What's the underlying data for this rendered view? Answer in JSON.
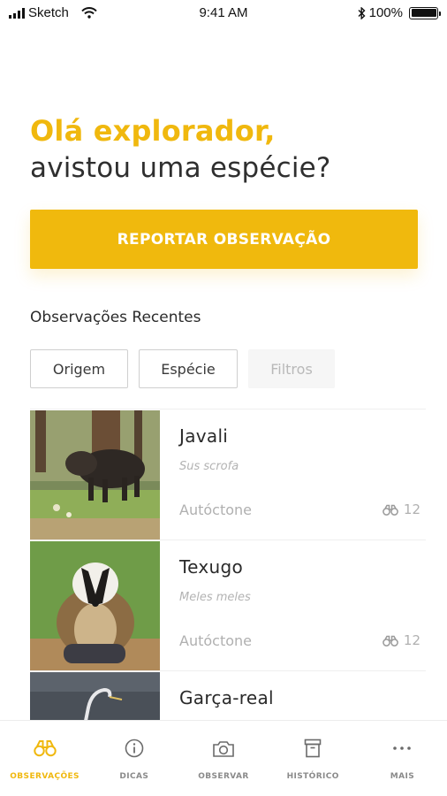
{
  "status_bar": {
    "carrier": "Sketch",
    "time": "9:41 AM",
    "battery": "100%"
  },
  "greeting": {
    "line1": "Olá explorador,",
    "line2": "avistou uma espécie?"
  },
  "cta": {
    "label": "REPORTAR OBSERVAÇÃO"
  },
  "section": {
    "title": "Observações Recentes"
  },
  "filters": {
    "origem": "Origem",
    "especie": "Espécie",
    "filtros": "Filtros"
  },
  "observations": [
    {
      "name": "Javali",
      "scientific": "Sus scrofa",
      "origin": "Autóctone",
      "count": "12"
    },
    {
      "name": "Texugo",
      "scientific": "Meles meles",
      "origin": "Autóctone",
      "count": "12"
    },
    {
      "name": "Garça-real",
      "scientific": "",
      "origin": "",
      "count": ""
    }
  ],
  "nav": {
    "items": [
      {
        "label": "OBSERVAÇÕES",
        "icon": "binoculars-icon",
        "active": true
      },
      {
        "label": "DICAS",
        "icon": "info-icon",
        "active": false
      },
      {
        "label": "OBSERVAR",
        "icon": "camera-icon",
        "active": false
      },
      {
        "label": "HISTÓRICO",
        "icon": "archive-icon",
        "active": false
      },
      {
        "label": "MAIS",
        "icon": "more-icon",
        "active": false
      }
    ]
  },
  "colors": {
    "accent": "#f0b90d",
    "muted": "#b0b0b0"
  }
}
